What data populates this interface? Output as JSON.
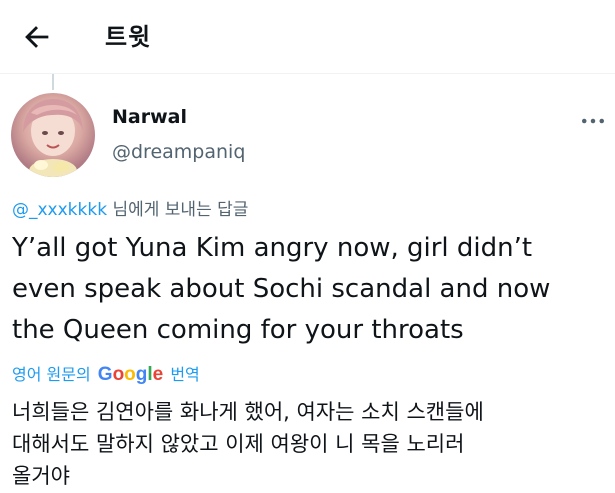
{
  "header": {
    "title": "트윗",
    "back_icon": "arrow-left-icon"
  },
  "tweet": {
    "author": {
      "name": "Narwal",
      "handle": "@dreampaniq",
      "avatar_icon": "profile-photo"
    },
    "more_icon": "more-dots-icon",
    "reply_mention": "@_xxxkkkk",
    "reply_suffix": " 님에게 보내는 답글",
    "text_lines": [
      "Y’all got Yuna Kim angry now, girl didn’t",
      "even speak about Sochi scandal and now",
      "the Queen coming for your throats"
    ],
    "translate": {
      "prefix": "영어 원문의 ",
      "brand_letters": [
        "G",
        "o",
        "o",
        "g",
        "l",
        "e"
      ],
      "brand_colors": [
        "#4285f4",
        "#ea4335",
        "#fbbc05",
        "#4285f4",
        "#34a853",
        "#ea4335"
      ],
      "suffix": " 번역"
    },
    "translated_lines": [
      "너희들은 김연아를 화나게 했어, 여자는 소치 스캔들에",
      "대해서도 말하지 않았고 이제 여왕이 니 목을 노리러",
      "올거야"
    ]
  },
  "colors": {
    "link": "#1d9bf0",
    "secondary_text": "#536471",
    "text": "#0f1419"
  }
}
